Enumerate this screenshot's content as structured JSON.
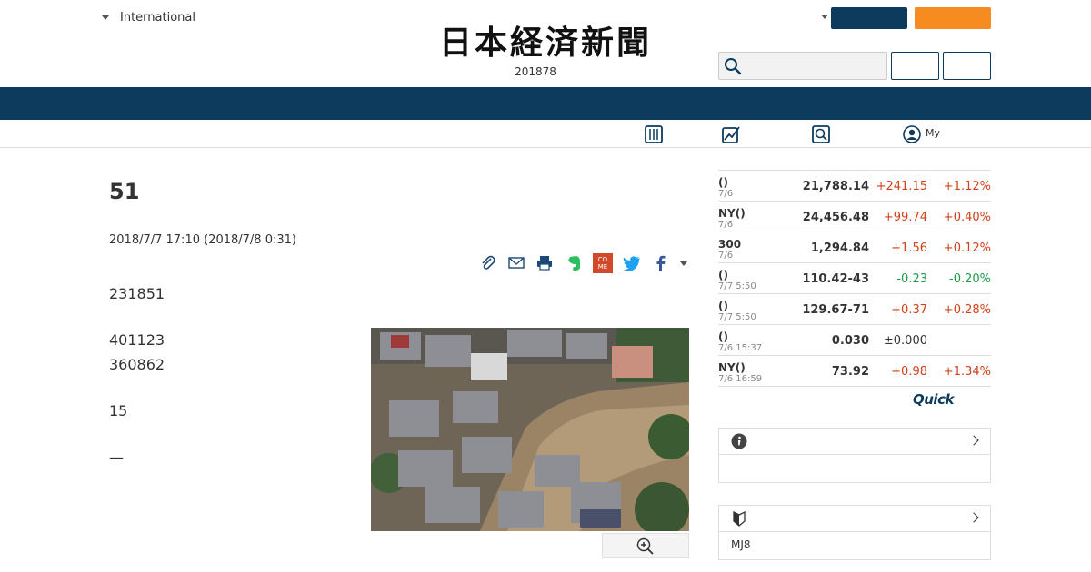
{
  "header": {
    "region_label": "International",
    "logo_text": "日本経済新聞",
    "edition_date": "201878",
    "search_placeholder": ""
  },
  "article": {
    "title": "51",
    "timestamp": "2018/7/7 17:10 (2018/7/8 0:31)",
    "paragraphs": [
      "231851",
      "401123",
      "360862",
      "15",
      "—"
    ]
  },
  "share_icons": [
    "clip-icon",
    "mail-icon",
    "print-icon",
    "evernote-icon",
    "come-icon",
    "twitter-icon",
    "facebook-icon",
    "more-caret-icon"
  ],
  "share": {
    "come_label": "CO ME"
  },
  "subnav": {
    "my_label": "My"
  },
  "market": {
    "rows": [
      {
        "name": "()",
        "time": "7/6",
        "value": "21,788.14",
        "change": "+241.15",
        "pct": "+1.12%",
        "dir": "up"
      },
      {
        "name": "NY()",
        "time": "7/6",
        "value": "24,456.48",
        "change": "+99.74",
        "pct": "+0.40%",
        "dir": "up"
      },
      {
        "name": "300",
        "time": "7/6",
        "value": "1,294.84",
        "change": "+1.56",
        "pct": "+0.12%",
        "dir": "up"
      },
      {
        "name": "()",
        "time": "7/7 5:50",
        "value": "110.42-43",
        "change": "-0.23",
        "pct": "-0.20%",
        "dir": "down"
      },
      {
        "name": "()",
        "time": "7/7 5:50",
        "value": "129.67-71",
        "change": "+0.37",
        "pct": "+0.28%",
        "dir": "up"
      },
      {
        "name": "()",
        "time": "7/6 15:37",
        "value": "0.030",
        "change": "±0.000",
        "pct": "",
        "dir": "flat"
      },
      {
        "name": "NY()",
        "time": "7/6 16:59",
        "value": "73.92",
        "change": "+0.98",
        "pct": "+1.34%",
        "dir": "up"
      }
    ],
    "provider": "Quick"
  },
  "side": {
    "info_body": "",
    "beginner_body": "MJ8"
  },
  "colors": {
    "navy": "#0c3b5e",
    "orange": "#f68c1f",
    "up": "#d0421b",
    "down": "#1f9c4c"
  }
}
